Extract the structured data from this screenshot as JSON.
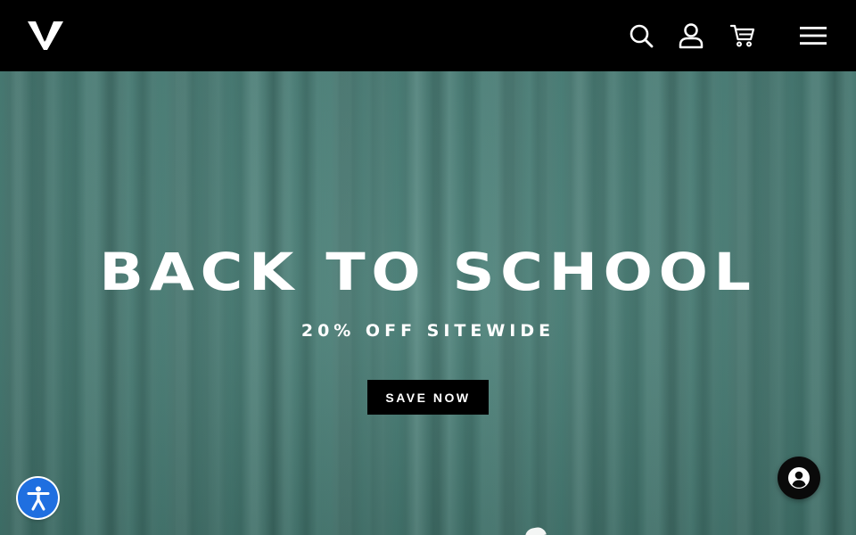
{
  "header": {
    "logo_icon": "v-logo-icon",
    "icons": [
      "search-icon",
      "account-icon",
      "cart-icon",
      "hamburger-menu-icon"
    ],
    "background": "#000000"
  },
  "hero": {
    "title": "BACK TO SCHOOL",
    "subtitle": "20% OFF SITEWIDE",
    "cta_label": "SAVE NOW",
    "background_color": "#4a8078"
  },
  "floating": {
    "accessibility_icon": "accessibility-icon",
    "accessibility_color": "#1f6fe0",
    "chat_icon": "user-circle-icon",
    "chat_color": "#0a0a0a"
  }
}
